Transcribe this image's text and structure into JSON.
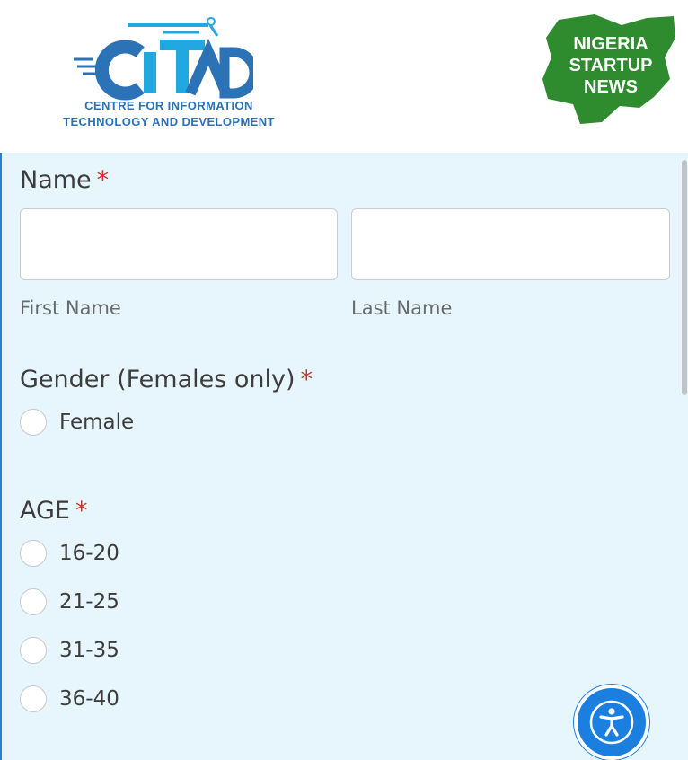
{
  "header": {
    "citad": {
      "brand": "CITAD",
      "line1": "CENTRE FOR INFORMATION",
      "line2": "TECHNOLOGY AND DEVELOPMENT",
      "color": "#2b72b6",
      "accent": "#22a8e0"
    },
    "nsn": {
      "line1": "NIGERIA",
      "line2": "STARTUP",
      "line3": "NEWS",
      "color": "#2e8b2e"
    }
  },
  "form": {
    "name": {
      "label": "Name",
      "required_mark": "*",
      "first_value": "",
      "last_value": "",
      "first_sublabel": "First Name",
      "last_sublabel": "Last Name"
    },
    "gender": {
      "label": "Gender (Females only)",
      "required_mark": "*",
      "options": [
        "Female"
      ]
    },
    "age": {
      "label": "AGE",
      "required_mark": "*",
      "options": [
        "16-20",
        "21-25",
        "31-35",
        "36-40"
      ]
    }
  },
  "accessibility": {
    "icon": "accessibility-icon",
    "color": "#1b7fe0"
  },
  "colors": {
    "panel_bg": "#e7f6fd",
    "required": "#c0392b"
  }
}
